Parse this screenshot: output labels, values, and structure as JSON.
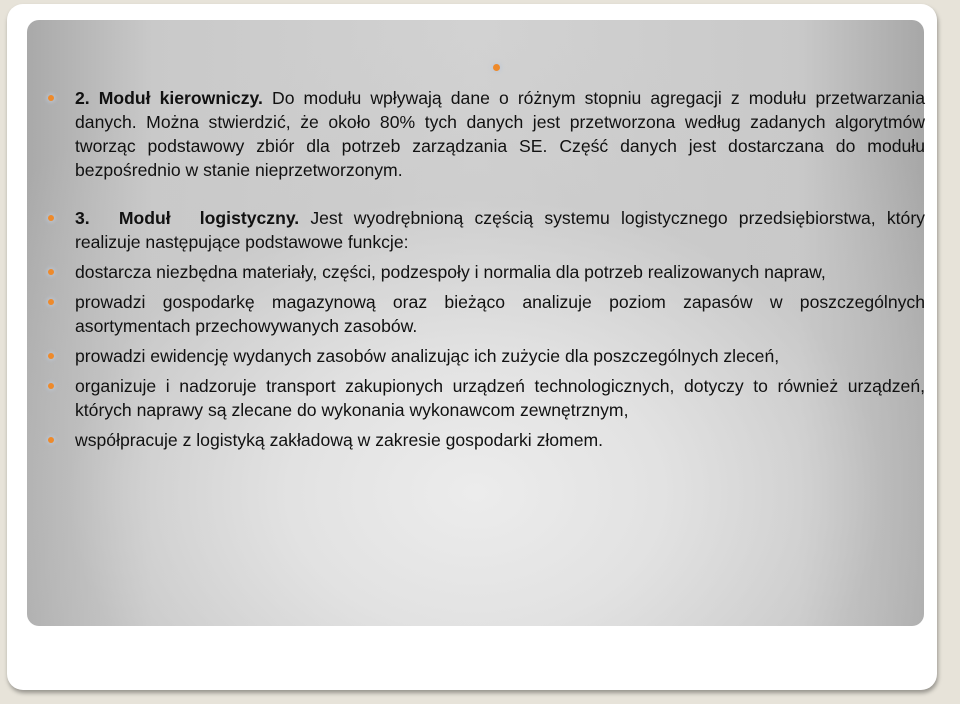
{
  "slide": {
    "top_bullet": "",
    "items": [
      {
        "bold": "2. Moduł kierowniczy.",
        "text": " Do modułu wpływają dane o różnym stopniu agregacji z modułu przetwarzania danych. Można stwierdzić, że około 80% tych danych jest przetworzona według zadanych algorytmów tworząc podstawowy zbiór dla potrzeb zarządzania SE. Część danych jest dostarczana do modułu bezpośrednio w  stanie nieprzetworzonym."
      },
      {
        "bold": "3. Moduł logistyczny.",
        "text": " Jest wyodrębnioną częścią systemu logistycznego przedsiębiorstwa, który realizuje następujące podstawowe funkcje:"
      },
      {
        "text": "dostarcza niezbędna materiały, części, podzespoły i normalia dla potrzeb realizowanych napraw,"
      },
      {
        "text": "prowadzi gospodarkę magazynową oraz bieżąco analizuje poziom zapasów w poszczególnych asortymentach przechowywanych zasobów."
      },
      {
        "text": "prowadzi ewidencję wydanych zasobów analizując ich zużycie dla poszczególnych zleceń,"
      },
      {
        "text": "organizuje i nadzoruje transport zakupionych urządzeń technologicznych, dotyczy to również urządzeń, których naprawy są zlecane do wykonania wykonawcom zewnętrznym,"
      },
      {
        "text": "współpracuje  z logistyką zakładową w zakresie gospodarki złomem."
      }
    ]
  },
  "colors": {
    "bullet": "#ee8a2b",
    "text": "#111111",
    "background": "#e7e3d9",
    "frame": "#ffffff"
  }
}
